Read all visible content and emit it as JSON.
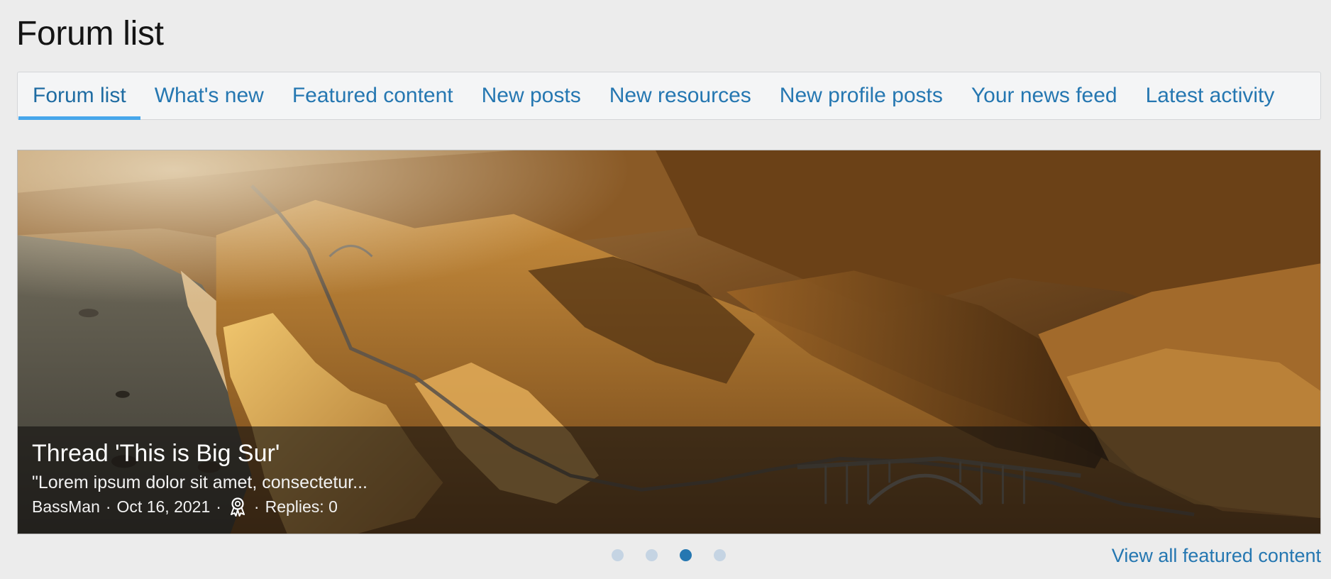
{
  "page": {
    "title": "Forum list"
  },
  "tabs": [
    {
      "label": "Forum list",
      "active": true
    },
    {
      "label": "What's new",
      "active": false
    },
    {
      "label": "Featured content",
      "active": false
    },
    {
      "label": "New posts",
      "active": false
    },
    {
      "label": "New resources",
      "active": false
    },
    {
      "label": "New profile posts",
      "active": false
    },
    {
      "label": "Your news feed",
      "active": false
    },
    {
      "label": "Latest activity",
      "active": false
    }
  ],
  "featured": {
    "title": "Thread 'This is Big Sur'",
    "snippet": "\"Lorem ipsum dolor sit amet, consectetur...",
    "author": "BassMan",
    "date": "Oct 16, 2021",
    "separator": "·",
    "award_icon": "award-icon",
    "replies": "Replies: 0"
  },
  "carousel": {
    "slide_count": 4,
    "active_index": 2
  },
  "links": {
    "view_all": "View all featured content"
  },
  "colors": {
    "link": "#2577b1",
    "tab_active_underline": "#47a7eb",
    "dot_inactive": "#c5d4e3",
    "dot_active": "#2577b1",
    "page_bg": "#ececec"
  }
}
